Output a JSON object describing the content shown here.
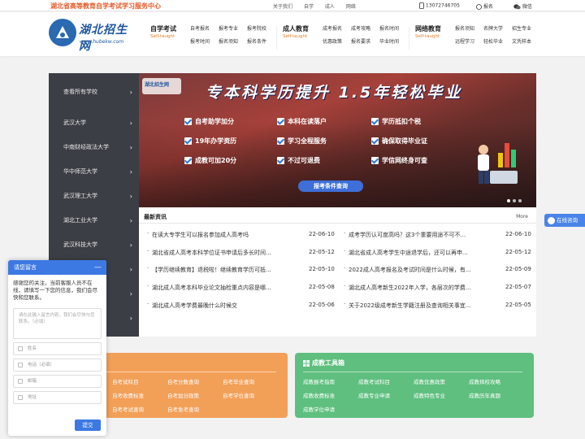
{
  "topbar": {
    "slogan": "湖北省高等教育自学考试学习服务中心",
    "links": [
      "关于我们",
      "自学",
      "成人",
      "网络"
    ],
    "phone": "13072746705",
    "register": "报名",
    "wechat": "微信"
  },
  "logo": {
    "name": "湖北招生网",
    "url": "www.hubekw.com"
  },
  "nav": [
    {
      "title": "自学考试",
      "sub": "Self-taught",
      "links": [
        [
          "自考报名",
          "报考专业",
          "报考院校"
        ],
        [
          "报考时间",
          "报名须知",
          "报名条件"
        ]
      ]
    },
    {
      "title": "成人教育",
      "sub": "Self-taught",
      "links": [
        [
          "成考报名",
          "成考攻略",
          "报名时间"
        ],
        [
          "优惠政策",
          "报名要求",
          "毕业时间"
        ]
      ]
    },
    {
      "title": "网络教育",
      "sub": "Self-taught",
      "links": [
        [
          "报名须知",
          "名牌大学",
          "招生专业"
        ],
        [
          "远程学习",
          "轻松毕业",
          "文凭样本"
        ]
      ]
    }
  ],
  "sidebar": [
    {
      "label": "查看所有学校"
    },
    {
      "label": "武汉大学"
    },
    {
      "label": "中南财经政法大学"
    },
    {
      "label": "华中师范大学"
    },
    {
      "label": "武汉理工大学"
    },
    {
      "label": "湖北工业大学"
    },
    {
      "label": "武汉科技大学"
    },
    {
      "label": ""
    },
    {
      "label": ""
    },
    {
      "label": ""
    }
  ],
  "banner": {
    "logo_text": "湖北招生网",
    "headline": "专本科学历提升 1.5年轻松毕业",
    "features": [
      "自考助学加分",
      "本科在读落户",
      "学历抵扣个税",
      "19年办学资历",
      "学习全程服务",
      "确保取得毕业证",
      "成教可加20分",
      "不过可退费",
      "学信网终身可查"
    ],
    "cta": "报考条件查询"
  },
  "news": {
    "title": "最新资讯",
    "more": "More",
    "left": [
      {
        "title": "在读大专学生可以报名参加成人高考吗",
        "date": "22-06-10"
      },
      {
        "title": "湖北省成人高考本科学位证书申请后多长时间...",
        "date": "22-05-12"
      },
      {
        "title": "【学历继续教育】退税啦！继续教育学历可抵...",
        "date": "22-05-10"
      },
      {
        "title": "湖北成人高考本科毕业论文抽检重点内容是哪...",
        "date": "22-05-08"
      },
      {
        "title": "湖北成人高考学费最晚什么时候交",
        "date": "22-05-06"
      }
    ],
    "right": [
      {
        "title": "成考学历认可度高吗？这3个重要用途不可不...",
        "date": "22-06-10"
      },
      {
        "title": "湖北省成人高考学生中途退学后，还可以再申...",
        "date": "22-05-12"
      },
      {
        "title": "2022成人高考报名及考试时间是什么时候，有...",
        "date": "22-05-09"
      },
      {
        "title": "湖北成人高考新生2022年入学，各层次的学费...",
        "date": "22-05-07"
      },
      {
        "title": "关于2022级成考新生学籍注册及查询相关事宜...",
        "date": "22-05-05"
      }
    ]
  },
  "card_self": {
    "title": "",
    "links": [
      "",
      "自考试科目",
      "自考分数查询",
      "自考毕业查询",
      "",
      "自考收费标准",
      "自考加分政策",
      "自考学位查询",
      "",
      "自考考试查询",
      "自考免考查询",
      ""
    ]
  },
  "card_adult": {
    "title": "成教工具箱",
    "links": [
      "成教报考指南",
      "成教考试科目",
      "成教优惠政策",
      "成教择校攻略",
      "成教收费标准",
      "成教专业申请",
      "成教特色专业",
      "成教历年真题",
      "成教学位申请",
      "",
      "",
      ""
    ]
  },
  "consult": {
    "label": "在线咨询"
  },
  "chat": {
    "title": "请您留言",
    "message": "感谢您的关注，当前客服人员不在线，请填写一下您的信息，我们会尽快和您联系。",
    "textarea_placeholder": "请在此输入留言内容，我们会尽快与您联系。（必填）",
    "fields": [
      "姓名",
      "电话（必填）",
      "邮箱",
      "地址"
    ],
    "submit": "提交"
  }
}
